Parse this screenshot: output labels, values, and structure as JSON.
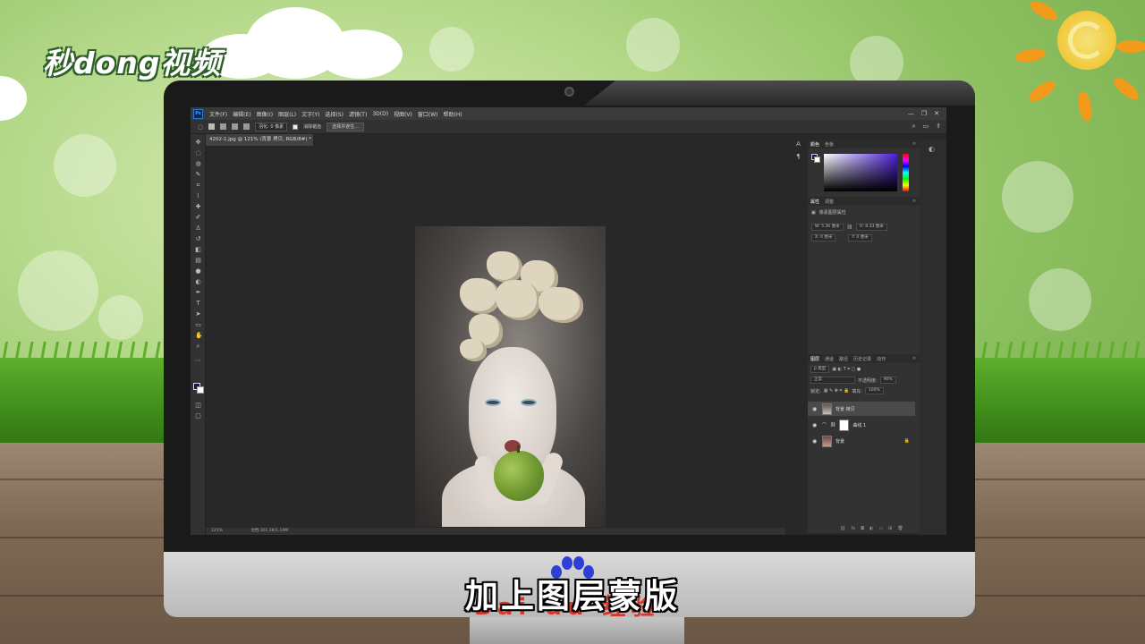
{
  "brand": {
    "logo_text": "秒dong视频"
  },
  "subtitle": "加上图层蒙版",
  "watermark": {
    "text": "Bai du 经验"
  },
  "photoshop": {
    "app_logo": "Ps",
    "menu": [
      "文件(F)",
      "编辑(E)",
      "图像(I)",
      "图层(L)",
      "文字(Y)",
      "选择(S)",
      "滤镜(T)",
      "3D(D)",
      "视图(V)",
      "窗口(W)",
      "帮助(H)"
    ],
    "window_controls": [
      "—",
      "❐",
      "✕"
    ],
    "options": {
      "feather": "羽化: 0 像素",
      "antialias": "消除锯齿",
      "select_mask": "选择并遮住..."
    },
    "document_tab": "4202-1.jpg @ 121% (背景 拷贝, RGB/8#) *",
    "status": {
      "zoom": "121%",
      "doc": "文档:301.1K/1.10M"
    },
    "colors": {
      "foreground": "#1b1460",
      "background": "#ffffff"
    },
    "panels": {
      "color": {
        "tabs": [
          "颜色",
          "色板"
        ]
      },
      "properties": {
        "tabs": [
          "属性",
          "调整"
        ],
        "title": "像素图层属性",
        "w": "W: 5.36 厘米",
        "h": "H: 8.33 厘米",
        "x": "X: 0 厘米",
        "y": "Y: 0 厘米"
      },
      "layers": {
        "tabs": [
          "图层",
          "通道",
          "路径",
          "历史记录",
          "动作"
        ],
        "filter": "ρ 类型",
        "blend_mode": "正常",
        "opacity_label": "不透明度:",
        "opacity": "90%",
        "lock_label": "锁定:",
        "fill_label": "填充:",
        "fill": "100%",
        "items": [
          {
            "name": "背景 拷贝",
            "selected": true
          },
          {
            "name": "曲线 1",
            "selected": false
          },
          {
            "name": "背景",
            "selected": false
          }
        ]
      }
    }
  }
}
